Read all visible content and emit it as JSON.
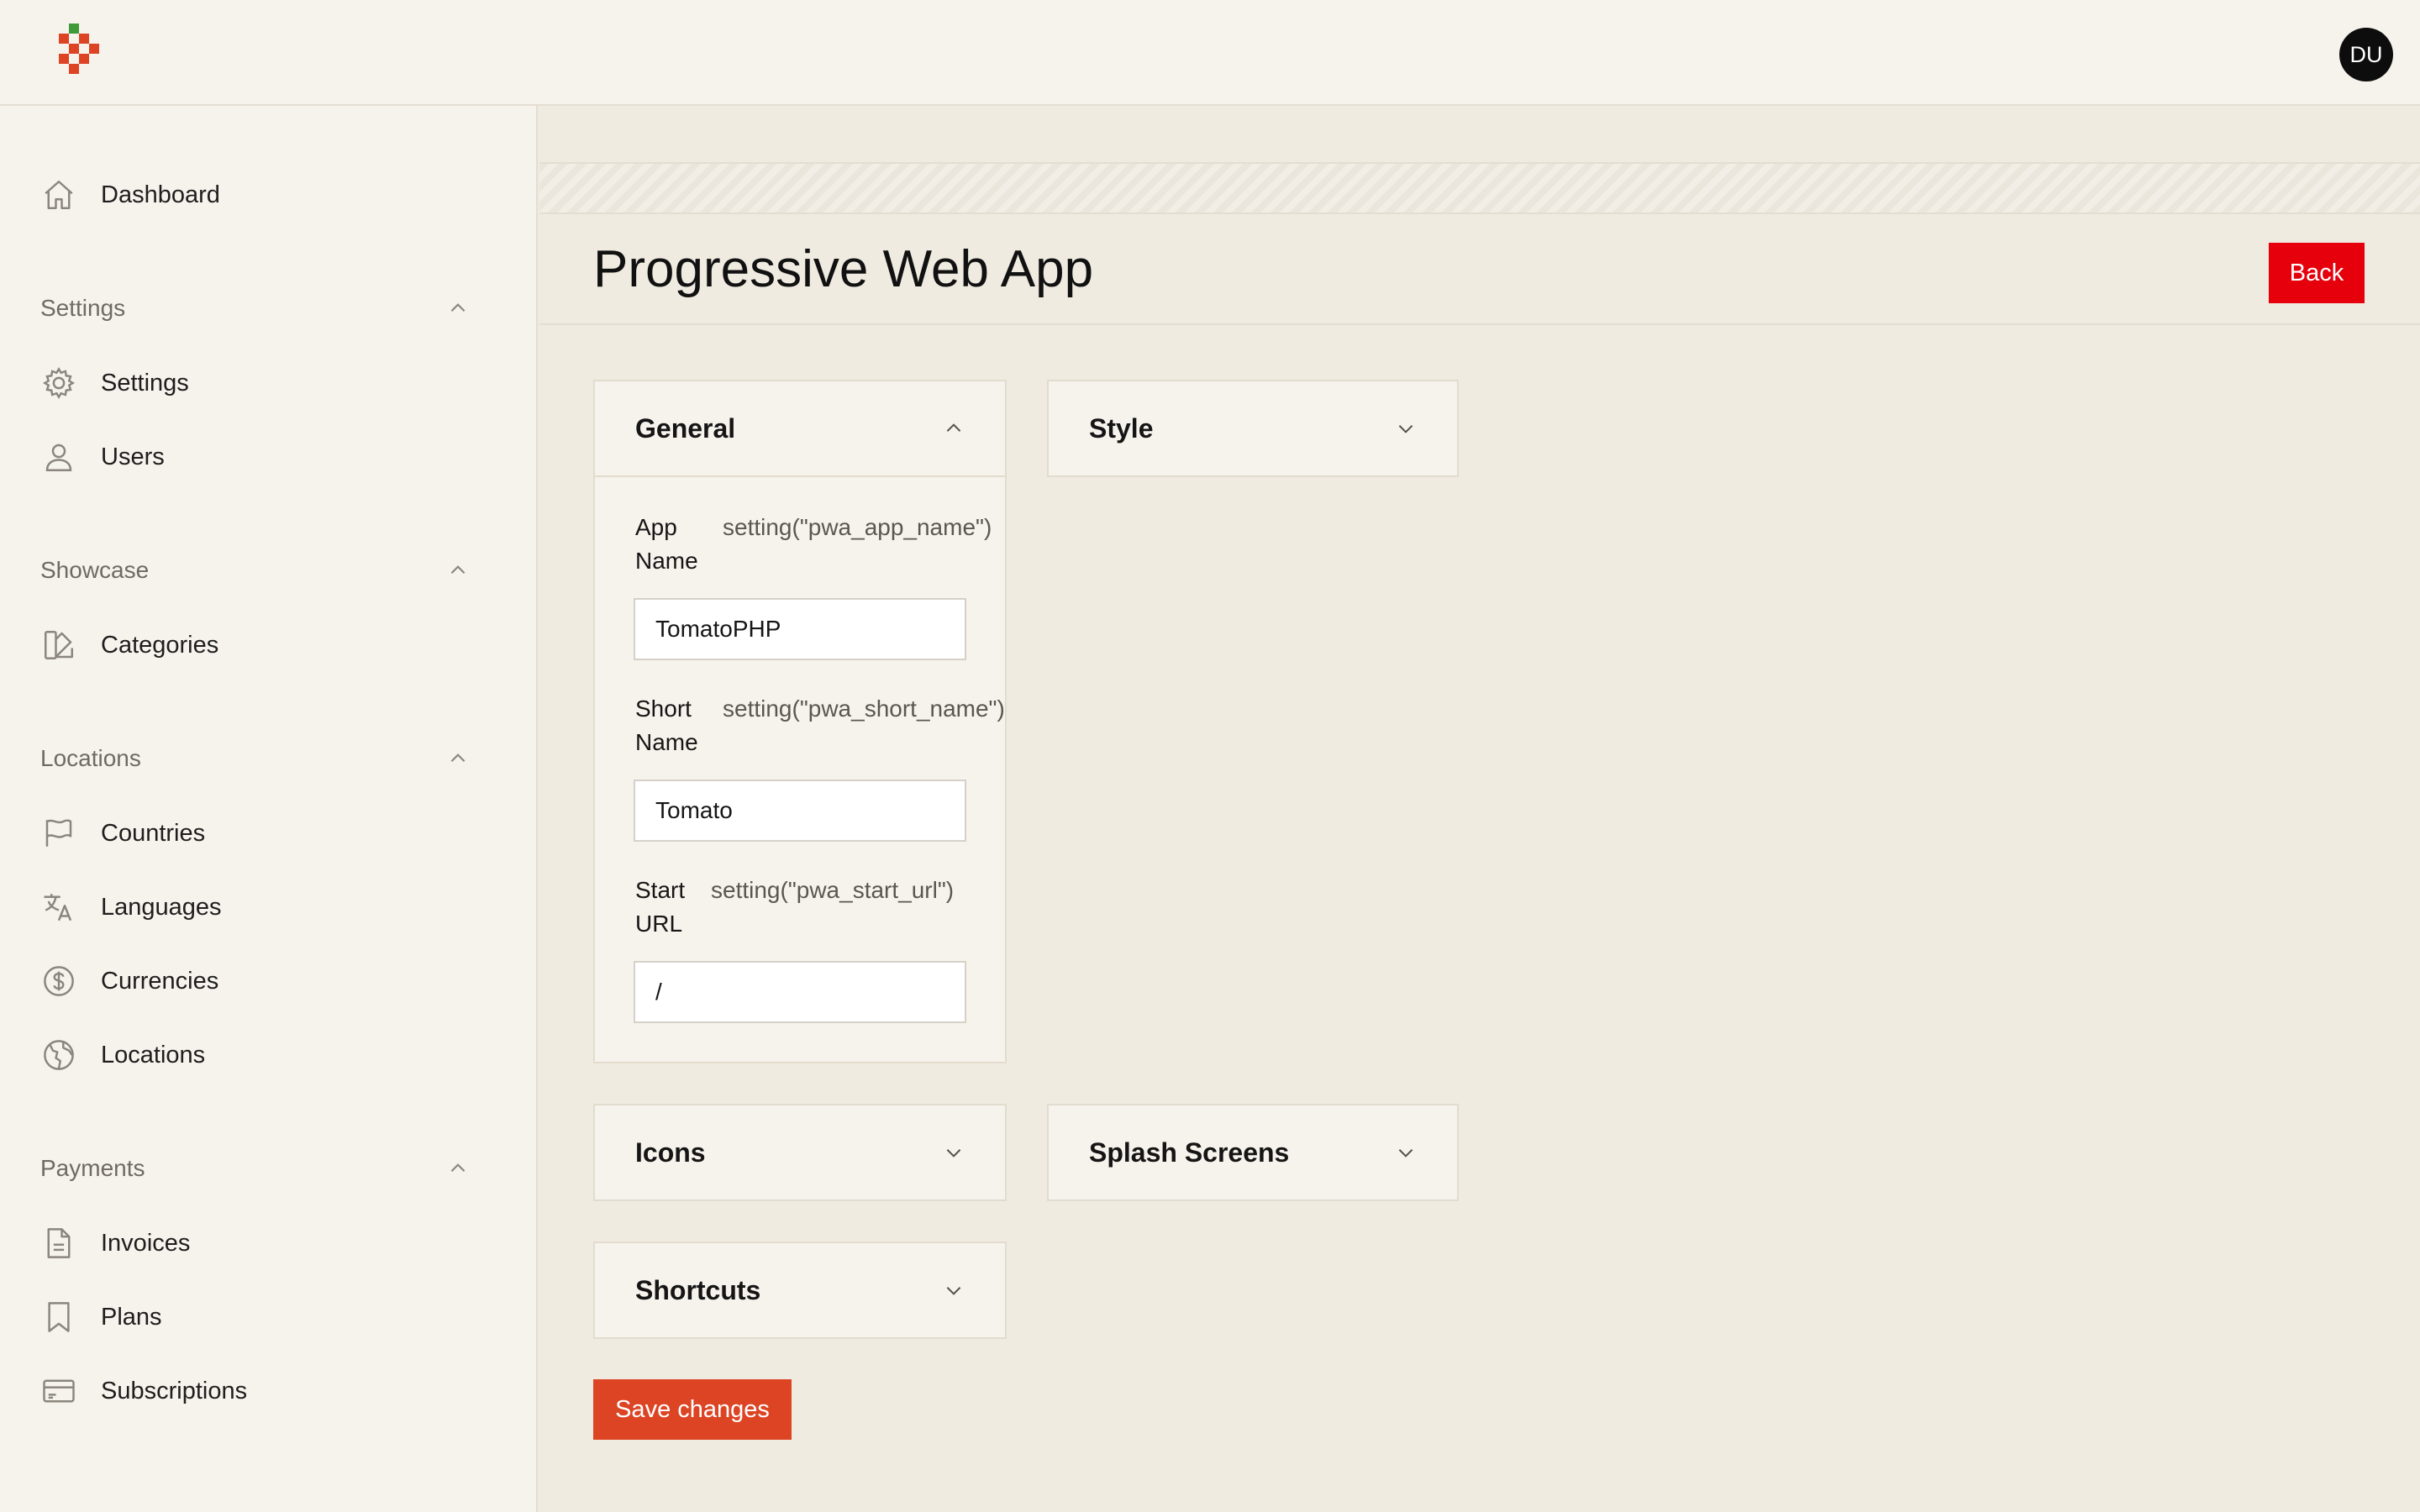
{
  "header": {
    "avatar_initials": "DU",
    "colors": {
      "logo_green": "#3f9a3a",
      "logo_red": "#dc4424"
    }
  },
  "sidebar": {
    "dashboard": {
      "label": "Dashboard",
      "icon": "home-icon"
    },
    "groups": [
      {
        "label": "Settings",
        "items": [
          {
            "label": "Settings",
            "icon": "gear-icon"
          },
          {
            "label": "Users",
            "icon": "user-icon"
          }
        ]
      },
      {
        "label": "Showcase",
        "items": [
          {
            "label": "Categories",
            "icon": "swatch-icon"
          }
        ]
      },
      {
        "label": "Locations",
        "items": [
          {
            "label": "Countries",
            "icon": "flag-icon"
          },
          {
            "label": "Languages",
            "icon": "translate-icon"
          },
          {
            "label": "Currencies",
            "icon": "dollar-icon"
          },
          {
            "label": "Locations",
            "icon": "globe-icon"
          }
        ]
      },
      {
        "label": "Payments",
        "items": [
          {
            "label": "Invoices",
            "icon": "document-icon"
          },
          {
            "label": "Plans",
            "icon": "bookmark-icon"
          },
          {
            "label": "Subscriptions",
            "icon": "credit-card-icon"
          }
        ]
      }
    ]
  },
  "page": {
    "title": "Progressive Web App",
    "back_label": "Back",
    "save_label": "Save changes",
    "colors": {
      "back": "#e5000c",
      "save": "#dc4424"
    }
  },
  "sections": {
    "general": {
      "title": "General",
      "fields": [
        {
          "label_1": "App",
          "label_2": "Name",
          "hint": "setting(\"pwa_app_name\")",
          "value": "TomatoPHP"
        },
        {
          "label_1": "Short",
          "label_2": "Name",
          "hint": "setting(\"pwa_short_name\")",
          "value": "Tomato"
        },
        {
          "label_1": "Start",
          "label_2": "URL",
          "hint": "setting(\"pwa_start_url\")",
          "value": "/"
        }
      ]
    },
    "style": {
      "title": "Style"
    },
    "icons": {
      "title": "Icons"
    },
    "splash": {
      "title": "Splash Screens"
    },
    "shortcuts": {
      "title": "Shortcuts"
    }
  }
}
